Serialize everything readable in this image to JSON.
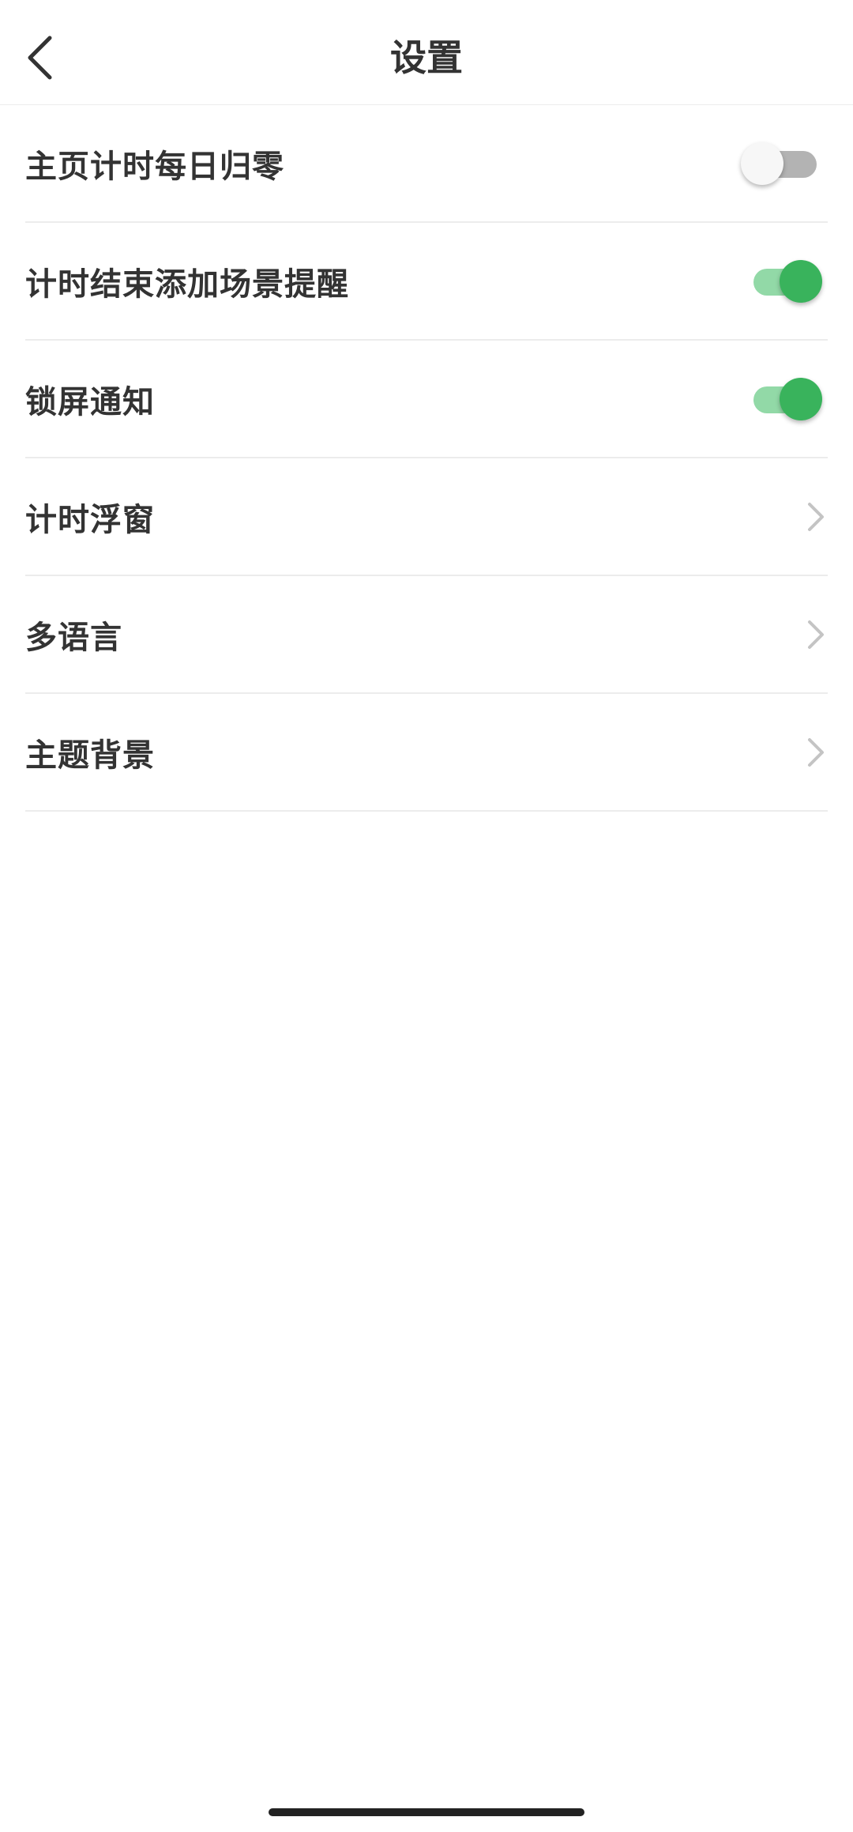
{
  "header": {
    "title": "设置",
    "back_icon": "chevron-left-icon"
  },
  "settings": [
    {
      "label": "主页计时每日归零",
      "control": "toggle",
      "enabled": false
    },
    {
      "label": "计时结束添加场景提醒",
      "control": "toggle",
      "enabled": true
    },
    {
      "label": "锁屏通知",
      "control": "toggle",
      "enabled": true
    },
    {
      "label": "计时浮窗",
      "control": "chevron",
      "icon": "chevron-right-icon"
    },
    {
      "label": "多语言",
      "control": "chevron",
      "icon": "chevron-right-icon"
    },
    {
      "label": "主题背景",
      "control": "chevron",
      "icon": "chevron-right-icon"
    }
  ],
  "colors": {
    "toggle_on_knob": "#39b35c",
    "toggle_on_track": "#92d9a7",
    "toggle_off_knob": "#f7f7f7",
    "toggle_off_track": "#b3b3b3",
    "text": "#333333",
    "divider": "#ececec",
    "chevron": "#c4c4c4"
  }
}
